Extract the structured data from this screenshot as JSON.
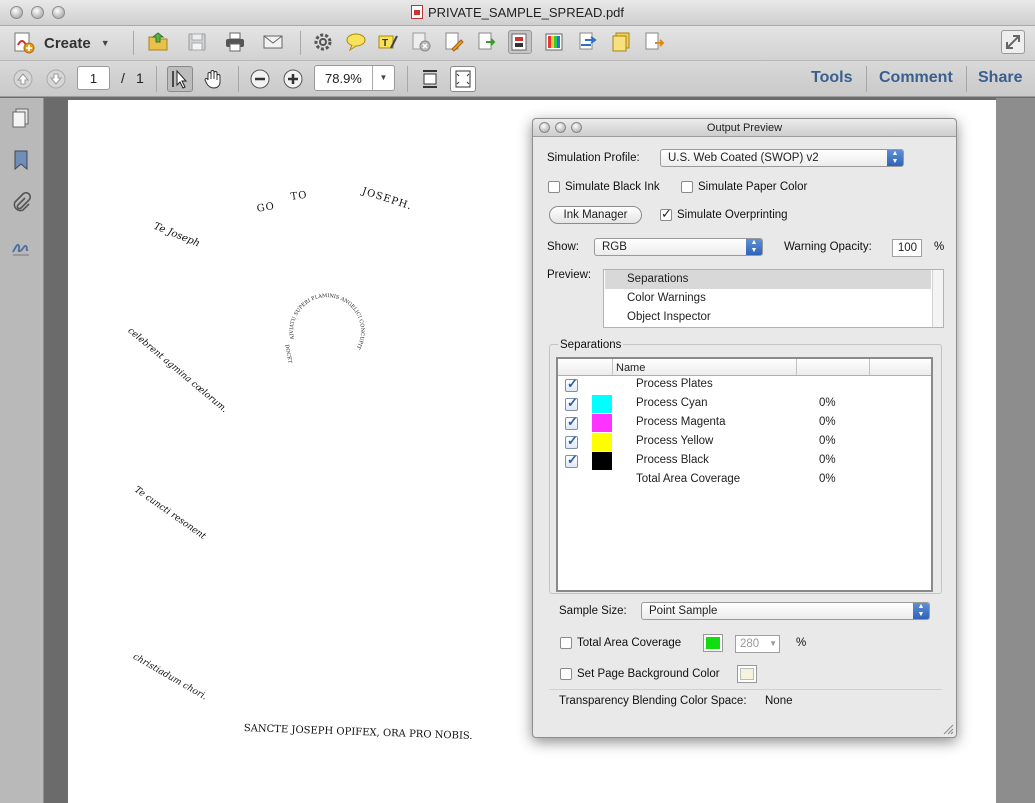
{
  "window": {
    "title": "PRIVATE_SAMPLE_SPREAD.pdf"
  },
  "toolbar": {
    "create_label": "Create",
    "icons": [
      "open-icon",
      "save-icon",
      "print-icon",
      "email-icon",
      "gear-icon",
      "comment-icon",
      "highlight-icon",
      "redact-icon",
      "edit-document-icon",
      "export-icon",
      "output-preview-icon",
      "color-icon",
      "convert-icon",
      "stamp-icon",
      "attach-icon",
      "fullscreen-icon"
    ]
  },
  "nav": {
    "page_current": "1",
    "page_sep": "/",
    "page_total": "1",
    "zoom": "78.9%",
    "links": {
      "tools": "Tools",
      "comment": "Comment",
      "share": "Share"
    }
  },
  "page": {
    "texts": [
      "Te Joseph",
      "GO",
      "TO",
      "JOSEPH.",
      "AIVIATU SUPERI FLAMINIS ANGELICI CONCUPIT SUBLIMIS",
      "DOCET",
      "celebrent agmina cœlorum.",
      "Te cuncti resonent",
      "christiadum chori.",
      "SANCTE JOSEPH OPIFEX, ORA PRO NOBIS."
    ]
  },
  "panel": {
    "title": "Output Preview",
    "simulation_profile_label": "Simulation Profile:",
    "simulation_profile_value": "U.S. Web Coated (SWOP) v2",
    "simulate_black_ink": "Simulate Black Ink",
    "simulate_paper_color": "Simulate Paper Color",
    "ink_manager": "Ink Manager",
    "simulate_overprinting": "Simulate Overprinting",
    "show_label": "Show:",
    "show_value": "RGB",
    "warning_opacity_label": "Warning Opacity:",
    "warning_opacity_value": "100",
    "warning_opacity_unit": "%",
    "preview_label": "Preview:",
    "preview_items": [
      "Separations",
      "Color Warnings",
      "Object Inspector"
    ],
    "separations_label": "Separations",
    "table_header_name": "Name",
    "separations": [
      {
        "name": "Process Plates",
        "pct": "",
        "color": ""
      },
      {
        "name": "Process Cyan",
        "pct": "0%",
        "color": "#00ffff"
      },
      {
        "name": "Process Magenta",
        "pct": "0%",
        "color": "#ff33ff"
      },
      {
        "name": "Process Yellow",
        "pct": "0%",
        "color": "#ffff00"
      },
      {
        "name": "Process Black",
        "pct": "0%",
        "color": "#000000"
      },
      {
        "name": "Total Area Coverage",
        "pct": "0%",
        "color": ""
      }
    ],
    "sample_size_label": "Sample Size:",
    "sample_size_value": "Point Sample",
    "total_area_coverage_label": "Total Area Coverage",
    "tac_value": "280",
    "tac_unit": "%",
    "tac_color": "#11dd11",
    "set_page_bg_label": "Set Page Background Color",
    "page_bg_color": "#f5f3dc",
    "transparency_label": "Transparency Blending Color Space:",
    "transparency_value": "None"
  }
}
